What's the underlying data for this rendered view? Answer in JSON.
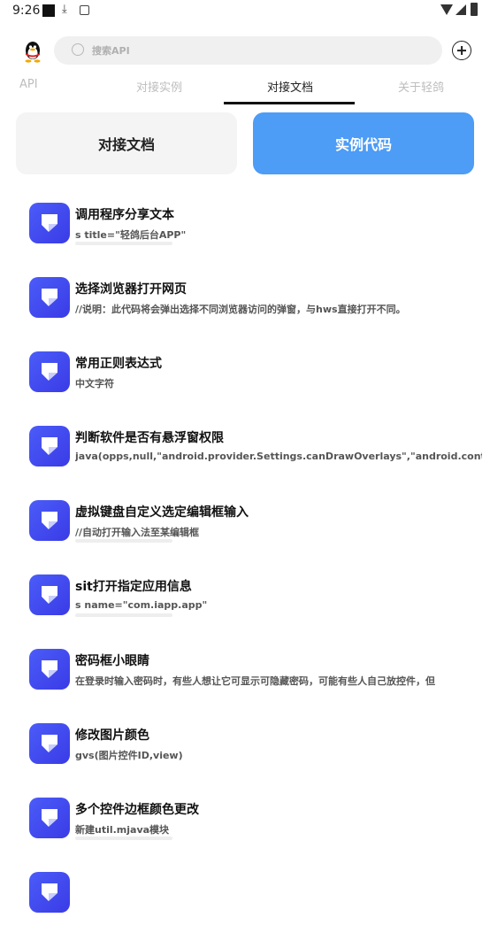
{
  "status_bar": {
    "time": "9:26"
  },
  "search": {
    "placeholder": "搜索API"
  },
  "tabs": [
    {
      "label": "API"
    },
    {
      "label": "对接实例"
    },
    {
      "label": "对接文档",
      "active": true
    },
    {
      "label": "关于轻鸽"
    }
  ],
  "segments": {
    "doc_label": "对接文档",
    "code_label": "实例代码",
    "active": "code",
    "active_color": "#4d9cf6"
  },
  "items": [
    {
      "title": "调用程序分享文本",
      "subtitle": "s title=\"轻鸽后台APP\"",
      "icon": "app-icon"
    },
    {
      "title": "选择浏览器打开网页",
      "subtitle": "//说明：此代码将会弹出选择不同浏览器访问的弹窗，与hws直接打开不同。",
      "icon": "app-icon"
    },
    {
      "title": "常用正则表达式",
      "subtitle": "中文字符",
      "icon": "app-icon"
    },
    {
      "title": "判断软件是否有悬浮窗权限",
      "subtitle": "java(opps,null,\"android.provider.Settings.canDrawOverlays\",\"android.cont",
      "icon": "app-icon"
    },
    {
      "title": "虚拟键盘自定义选定编辑框输入",
      "subtitle": "//自动打开输入法至某编辑框",
      "icon": "app-icon"
    },
    {
      "title": "sit打开指定应用信息",
      "subtitle": "s name=\"com.iapp.app\"",
      "icon": "app-icon"
    },
    {
      "title": "密码框小眼睛",
      "subtitle": "在登录时输入密码时，有些人想让它可显示可隐藏密码，可能有些人自己放控件，但",
      "icon": "app-icon"
    },
    {
      "title": "修改图片颜色",
      "subtitle": "gvs(图片控件ID,view)",
      "icon": "app-icon"
    },
    {
      "title": "多个控件边框颜色更改",
      "subtitle": "新建util.mjava模块",
      "icon": "app-icon"
    }
  ]
}
